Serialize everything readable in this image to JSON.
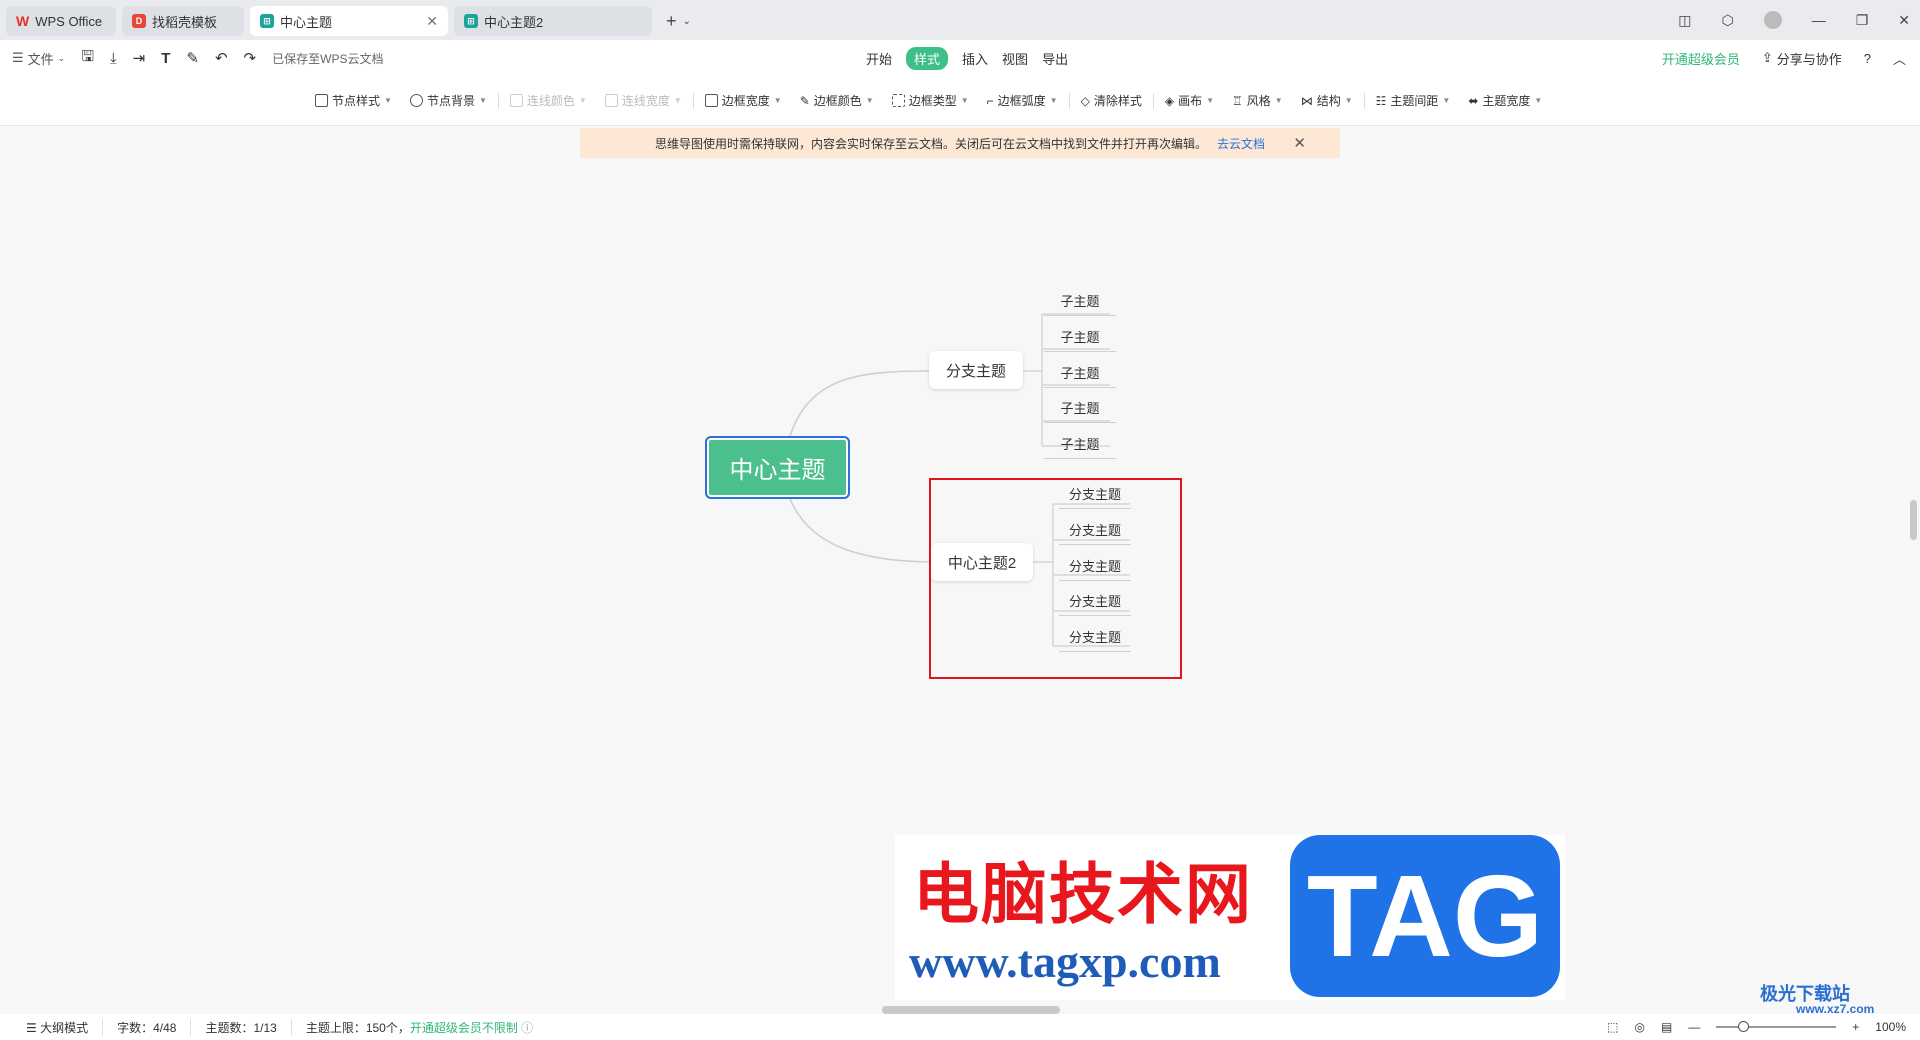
{
  "tabs": [
    {
      "label": "WPS Office",
      "icon": "wps-logo-icon",
      "state": "inactive"
    },
    {
      "label": "找稻壳模板",
      "icon": "docer-icon",
      "state": "inactive"
    },
    {
      "label": "中心主题",
      "icon": "mindmap-icon",
      "state": "active"
    },
    {
      "label": "中心主题2",
      "icon": "mindmap-icon",
      "state": "inactive"
    }
  ],
  "toolbar": {
    "file_label": "文件",
    "saved_status": "已保存至WPS云文档"
  },
  "menu": {
    "items": [
      "开始",
      "样式",
      "插入",
      "视图",
      "导出"
    ],
    "active": "样式",
    "vip_label": "开通超级会员",
    "share_label": "分享与协作"
  },
  "format_toolbar": {
    "node_style": "节点样式",
    "node_background": "节点背景",
    "line_color": "连线颜色",
    "line_width": "连线宽度",
    "border_width": "边框宽度",
    "border_color": "边框颜色",
    "border_type": "边框类型",
    "border_radius": "边框弧度",
    "clear_style": "清除样式",
    "canvas": "画布",
    "theme_style": "风格",
    "structure": "结构",
    "topic_spacing": "主题间距",
    "topic_width": "主题宽度"
  },
  "notice": {
    "text": "思维导图使用时需保持联网，内容会实时保存至云文档。关闭后可在云文档中找到文件并打开再次编辑。",
    "link": "去云文档"
  },
  "mindmap": {
    "central": "中心主题",
    "branch1": {
      "label": "分支主题",
      "children": [
        "子主题",
        "子主题",
        "子主题",
        "子主题",
        "子主题"
      ]
    },
    "branch2": {
      "label": "中心主题2",
      "children": [
        "分支主题",
        "分支主题",
        "分支主题",
        "分支主题",
        "分支主题"
      ]
    }
  },
  "watermark": {
    "red_text": "电脑技术网",
    "url": "www.tagxp.com",
    "tag": "TAG",
    "site2": "极光下载站",
    "site2_url": "www.xz7.com"
  },
  "status": {
    "outline_mode": "大纲模式",
    "word_count": "字数：4/48",
    "topic_count": "主题数：1/13",
    "topic_limit": "主题上限：150个，",
    "vip_unlimited": "开通超级会员不限制",
    "zoom": "100%"
  },
  "colors": {
    "accent_green": "#3dbf87",
    "central_fill": "#4cc08c",
    "selection_blue": "#2b72d6",
    "highlight_red": "#e0151b",
    "notice_bg": "#fde8d6"
  }
}
